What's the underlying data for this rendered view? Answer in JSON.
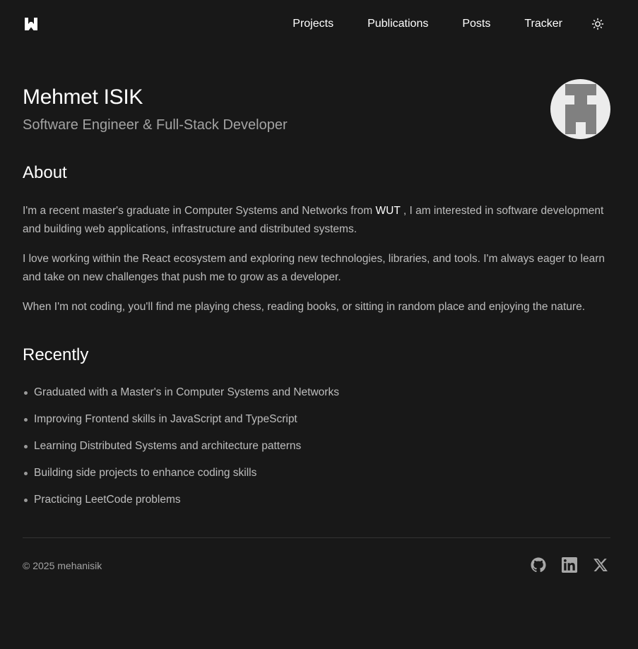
{
  "header": {
    "logo_icon": "w-logo-icon",
    "nav": [
      {
        "label": "Projects"
      },
      {
        "label": "Publications"
      },
      {
        "label": "Posts"
      },
      {
        "label": "Tracker"
      }
    ],
    "theme_icon": "sun-icon"
  },
  "hero": {
    "name": "Mehmet ISIK",
    "role": "Software Engineer & Full-Stack Developer",
    "avatar_icon": "avatar-logo"
  },
  "about": {
    "title": "About",
    "p1_before": "I'm a recent master's graduate in Computer Systems and Networks from ",
    "p1_link": "WUT",
    "p1_after": " , I am interested in software development and building web applications, infrastructure and distributed systems.",
    "p2": "I love working within the React ecosystem and exploring new technologies, libraries, and tools. I'm always eager to learn and take on new challenges that push me to grow as a developer.",
    "p3": "When I'm not coding, you'll find me playing chess, reading books, or sitting in random place and enjoying the nature."
  },
  "recently": {
    "title": "Recently",
    "items": [
      {
        "text": "Graduated with a Master's in Computer Systems and Networks"
      },
      {
        "text": "Improving Frontend skills in JavaScript and TypeScript"
      },
      {
        "text": "Learning Distributed Systems and architecture patterns"
      },
      {
        "text": "Building side projects to enhance coding skills"
      },
      {
        "text": "Practicing LeetCode problems"
      }
    ]
  },
  "footer": {
    "copyright": "© 2025 mehanisik",
    "social": [
      {
        "icon": "github-icon"
      },
      {
        "icon": "linkedin-icon"
      },
      {
        "icon": "x-twitter-icon"
      }
    ]
  },
  "colors": {
    "background": "#181818",
    "text_primary": "#ffffff",
    "text_secondary": "#bdbdbd",
    "text_muted": "#a3a3a3"
  }
}
